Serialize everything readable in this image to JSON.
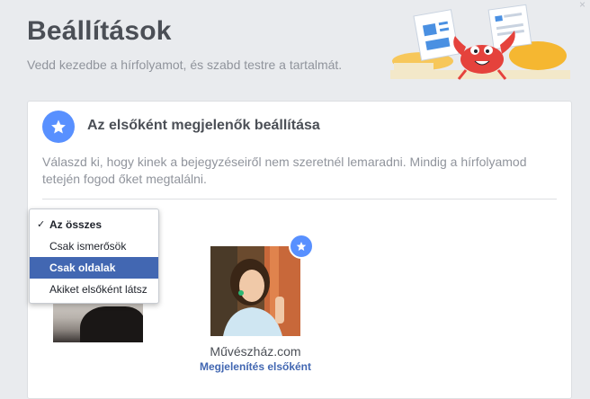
{
  "header": {
    "title": "Beállítások",
    "subtitle": "Vedd kezedbe a hírfolyamot, és szabd testre a tartalmát."
  },
  "section": {
    "title": "Az elsőként megjelenők beállítása",
    "description": "Válaszd ki, hogy kinek a bejegyzéseiről nem szeretnél lemaradni. Mindig a hírfolyamod tetején fogod őket megtalálni."
  },
  "filter_menu": {
    "items": [
      {
        "label": "Az összes",
        "checked": true
      },
      {
        "label": "Csak ismerősök"
      },
      {
        "label": "Csak oldalak",
        "highlighted": true
      },
      {
        "label": "Akiket elsőként látsz"
      }
    ],
    "check_mark": "✓"
  },
  "page_card": {
    "name": "Művészház.com",
    "action": "Megjelenítés elsőként"
  },
  "colors": {
    "accent": "#5890ff",
    "link": "#4267b2",
    "background": "#e9ebee"
  }
}
